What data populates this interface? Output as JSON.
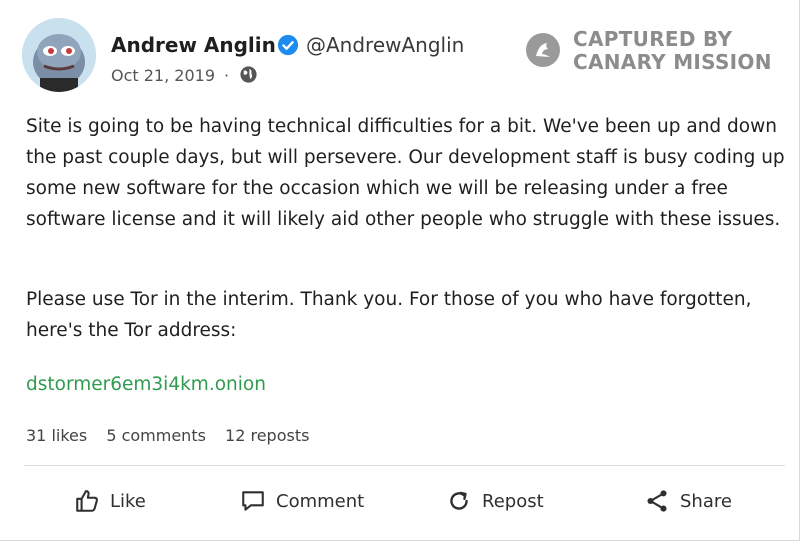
{
  "post": {
    "author_name": "Andrew Anglin",
    "author_handle": "@AndrewAnglin",
    "date": "Oct 21, 2019",
    "separator": "·",
    "visibility_icon": "globe-icon",
    "paragraphs": [
      "Site is going to be having technical difficulties for a bit. We've been up and down the past couple days, but will persevere. Our development staff is busy coding up some new software for the occasion which we will be releasing under a free software license and it will likely aid other people who struggle with these issues.",
      "Please use Tor in the interim. Thank you. For those of you who have forgotten, here's the Tor address:"
    ],
    "link_text": "dstormer6em3i4km.onion",
    "link_color": "#2e9b4e",
    "verified_color": "#1d8bf0"
  },
  "stats": {
    "likes": "31 likes",
    "comments": "5 comments",
    "reposts": "12 reposts"
  },
  "actions": {
    "like": "Like",
    "comment": "Comment",
    "repost": "Repost",
    "share": "Share"
  },
  "watermark": {
    "line1": "CAPTURED BY",
    "line2": "CANARY MISSION"
  }
}
